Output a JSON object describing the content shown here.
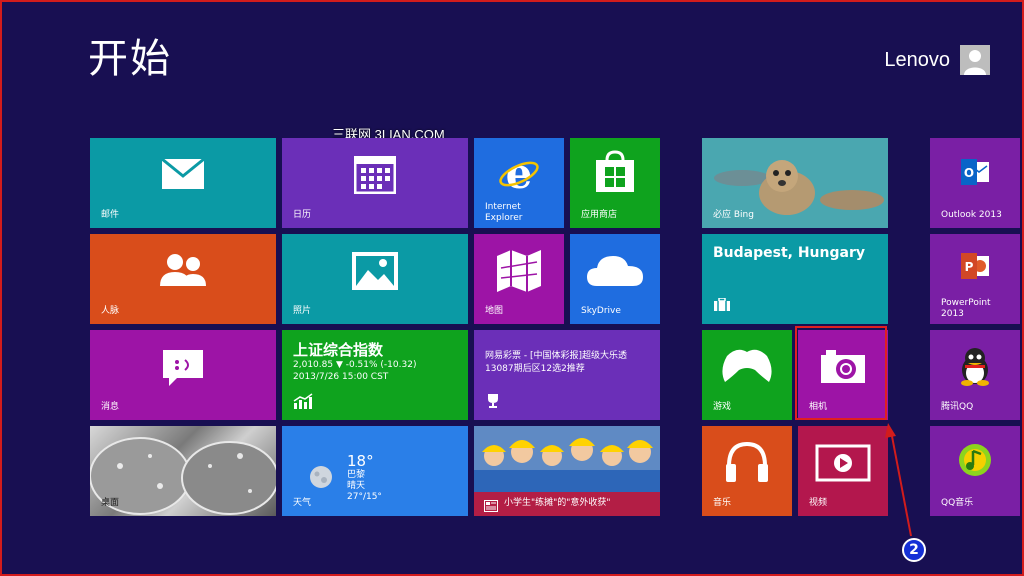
{
  "screen": {
    "title": "开始",
    "user_name": "Lenovo",
    "watermark": "三联网 3LIAN.COM"
  },
  "tiles": {
    "mail": {
      "label": "邮件"
    },
    "calendar": {
      "label": "日历"
    },
    "ie": {
      "label_line1": "Internet",
      "label_line2": "Explorer"
    },
    "store": {
      "label": "应用商店"
    },
    "people": {
      "label": "人脉"
    },
    "photos": {
      "label": "照片"
    },
    "maps": {
      "label": "地图"
    },
    "skydrive": {
      "label": "SkyDrive"
    },
    "messaging": {
      "label": "消息"
    },
    "finance": {
      "title": "上证综合指数",
      "line1": "2,010.85  ▼ -0.51% (-10.32)",
      "line2": "2013/7/26 15:00 CST"
    },
    "news_lottery": {
      "text": "网易彩票 - [中国体彩报]超级大乐透13087期后区12选2推荐"
    },
    "desktop": {
      "label": "桌面"
    },
    "weather": {
      "temp": "18°",
      "city": "巴黎",
      "condition": "晴天",
      "range": "27°/15°",
      "label": "天气"
    },
    "news_photo": {
      "caption": "小学生\"练摊\"的\"意外收获\""
    },
    "bing": {
      "label": "必应 Bing"
    },
    "travel": {
      "city": "Budapest, Hungary"
    },
    "games": {
      "label": "游戏"
    },
    "camera": {
      "label": "相机"
    },
    "music": {
      "label": "音乐"
    },
    "video": {
      "label": "视频"
    },
    "outlook": {
      "label": "Outlook 2013"
    },
    "powerpoint": {
      "label_line1": "PowerPoint",
      "label_line2": "2013"
    },
    "qq": {
      "label": "腾讯QQ"
    },
    "qqmusic": {
      "label": "QQ音乐"
    }
  },
  "annotation": {
    "step_number": "2"
  },
  "icons": [
    "mail-icon",
    "calendar-icon",
    "ie-icon",
    "store-icon",
    "people-icon",
    "photos-icon",
    "maps-icon",
    "skydrive-icon",
    "messaging-icon",
    "finance-icon",
    "trophy-icon",
    "weather-icon",
    "news-icon",
    "travel-icon",
    "games-icon",
    "camera-icon",
    "music-icon",
    "video-icon",
    "outlook-icon",
    "powerpoint-icon",
    "qq-icon",
    "qqmusic-icon"
  ],
  "colors": {
    "background": "#180f52",
    "annotation_red": "#e02020",
    "callout_blue": "#1530d6"
  }
}
